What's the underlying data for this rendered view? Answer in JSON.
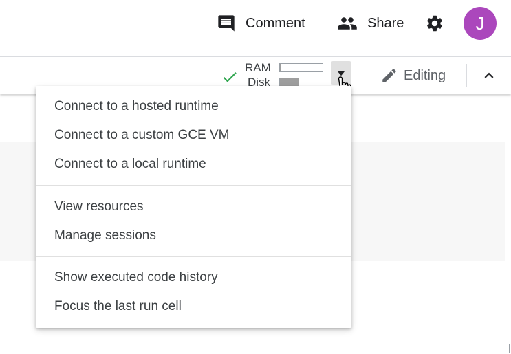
{
  "header": {
    "comment_label": "Comment",
    "share_label": "Share",
    "avatar_initial": "J",
    "avatar_color": "#ab47bc"
  },
  "toolbar": {
    "ram_label": "RAM",
    "disk_label": "Disk",
    "ram_usage_fraction": 0.04,
    "disk_usage_fraction": 0.45,
    "editing_label": "Editing",
    "status_color": "#34a853"
  },
  "menu": {
    "groups": [
      [
        "Connect to a hosted runtime",
        "Connect to a custom GCE VM",
        "Connect to a local runtime"
      ],
      [
        "View resources",
        "Manage sessions"
      ],
      [
        "Show executed code history",
        "Focus the last run cell"
      ]
    ]
  }
}
